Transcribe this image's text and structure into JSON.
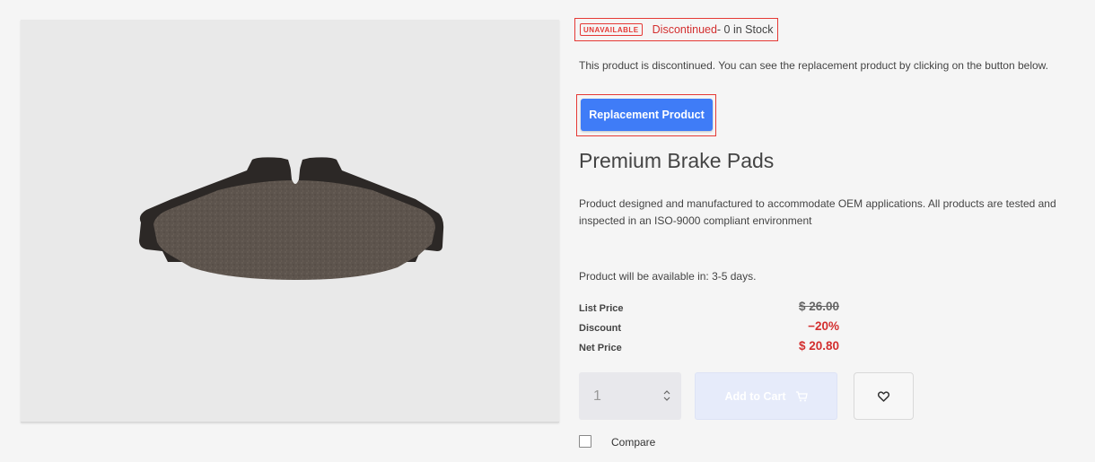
{
  "product": {
    "image_alt": "Premium Brake Pads product image",
    "status": {
      "badge": "UNAVAILABLE",
      "state": "Discontinued",
      "stock": " - 0 in Stock"
    },
    "discontinued_message": "This product is discontinued. You can see the replacement product by clicking on the button below.",
    "replacement_button": "Replacement Product",
    "title": "Premium Brake Pads",
    "description": "Product designed and manufactured to accommodate OEM applications. All products are tested and inspected in an ISO-9000 compliant environment",
    "availability": "Product will be available in: 3-5 days.",
    "pricing": {
      "list_label": "List Price",
      "list_value": "$ 26.00",
      "discount_label": "Discount",
      "discount_value": "−20%",
      "net_label": "Net Price",
      "net_value": "$ 20.80"
    },
    "quantity": "1",
    "add_to_cart": "Add to Cart",
    "compare_label": "Compare",
    "compare_checked": false
  },
  "colors": {
    "accent": "#3f7cf7",
    "alert": "#e53935",
    "price_red": "#d32f2f"
  },
  "icons": {
    "cart": "cart-icon",
    "wishlist": "heart-icon",
    "stepper": "stepper-arrows-icon"
  }
}
